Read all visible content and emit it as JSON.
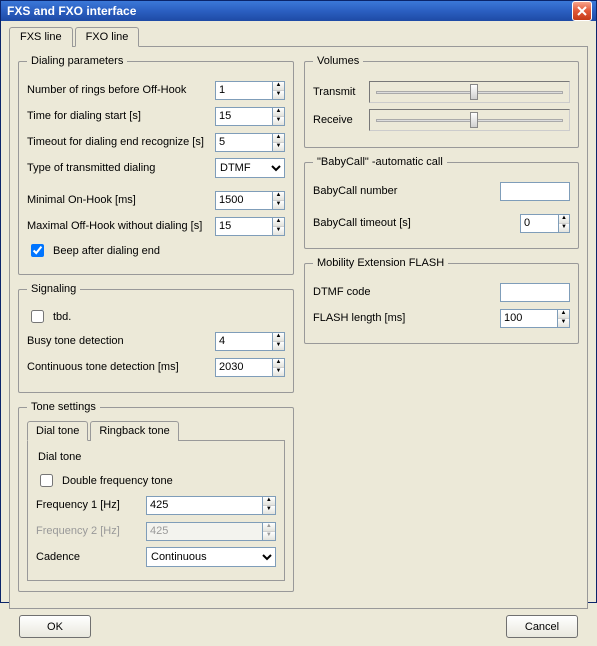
{
  "window": {
    "title": "FXS and FXO interface"
  },
  "tabs": {
    "fxs": "FXS line",
    "fxo": "FXO line"
  },
  "dialing": {
    "legend": "Dialing parameters",
    "rings_label": "Number of rings before Off-Hook",
    "rings_value": "1",
    "start_label": "Time for dialing start [s]",
    "start_value": "15",
    "timeout_label": "Timeout for dialing end recognize [s]",
    "timeout_value": "5",
    "type_label": "Type of transmitted dialing",
    "type_value": "DTMF",
    "min_onhook_label": "Minimal On-Hook [ms]",
    "min_onhook_value": "1500",
    "max_offhook_label": "Maximal Off-Hook without dialing [s]",
    "max_offhook_value": "15",
    "beep_label": "Beep after dialing end",
    "beep_checked": true
  },
  "signaling": {
    "legend": "Signaling",
    "tbd_label": "tbd.",
    "busy_label": "Busy tone detection",
    "busy_value": "4",
    "cont_label": "Continuous tone detection [ms]",
    "cont_value": "2030"
  },
  "tone": {
    "legend": "Tone settings",
    "tab_dial": "Dial tone",
    "tab_ringback": "Ringback tone",
    "inner_legend": "Dial tone",
    "double_label": "Double frequency tone",
    "freq1_label": "Frequency 1 [Hz]",
    "freq1_value": "425",
    "freq2_label": "Frequency 2 [Hz]",
    "freq2_value": "425",
    "cadence_label": "Cadence",
    "cadence_value": "Continuous"
  },
  "volumes": {
    "legend": "Volumes",
    "transmit_label": "Transmit",
    "receive_label": "Receive"
  },
  "babycall": {
    "legend": "\"BabyCall\" -automatic call",
    "number_label": "BabyCall number",
    "number_value": "",
    "timeout_label": "BabyCall timeout [s]",
    "timeout_value": "0"
  },
  "mobflash": {
    "legend": "Mobility Extension FLASH",
    "dtmf_label": "DTMF code",
    "dtmf_value": "",
    "flash_label": "FLASH length [ms]",
    "flash_value": "100"
  },
  "buttons": {
    "ok": "OK",
    "cancel": "Cancel"
  }
}
